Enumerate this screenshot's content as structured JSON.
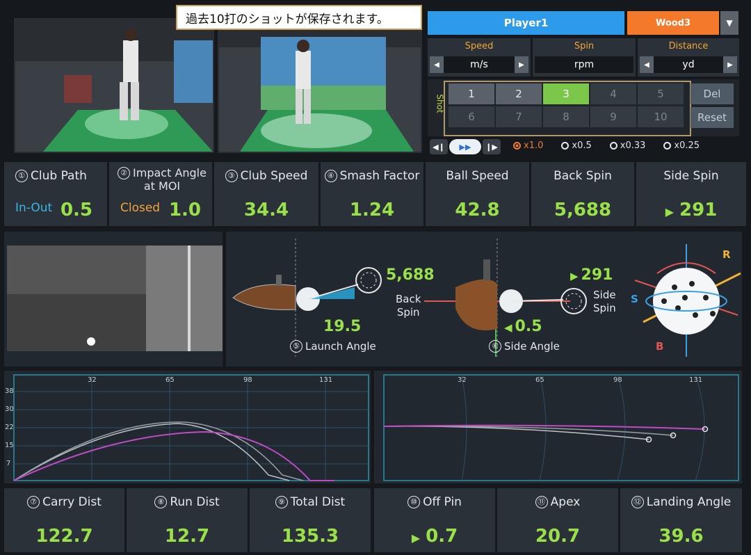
{
  "tooltip": "過去10打のショットが保存されます。",
  "player": {
    "name": "Player1",
    "club": "Wood3"
  },
  "units": [
    {
      "label": "Speed",
      "value": "m/s"
    },
    {
      "label": "Spin",
      "value": "rpm"
    },
    {
      "label": "Distance",
      "value": "yd"
    }
  ],
  "shots": {
    "label": "Shot",
    "items": [
      "1",
      "2",
      "3",
      "4",
      "5",
      "6",
      "7",
      "8",
      "9",
      "10"
    ],
    "selected": "3",
    "del": "Del",
    "reset": "Reset"
  },
  "playback": {
    "speeds": [
      "x1.0",
      "x0.5",
      "x0.33",
      "x0.25"
    ],
    "selected": "x1.0"
  },
  "metrics": [
    {
      "num": "①",
      "title": "Club Path",
      "sub": "In-Out",
      "value": "0.5"
    },
    {
      "num": "②",
      "title": "Impact Angle",
      "title2": "at MOI",
      "sub": "Closed",
      "value": "1.0"
    },
    {
      "num": "③",
      "title": "Club Speed",
      "value": "34.4"
    },
    {
      "num": "④",
      "title": "Smash Factor",
      "value": "1.24"
    },
    {
      "title": "Ball Speed",
      "value": "42.8"
    },
    {
      "title": "Back Spin",
      "value": "5,688"
    },
    {
      "title": "Side Spin",
      "value": "291"
    }
  ],
  "launch": {
    "backspin": "5,688",
    "backspin_label1": "Back",
    "backspin_label2": "Spin",
    "angle": "19.5",
    "num": "⑤",
    "label": "Launch Angle"
  },
  "side": {
    "sidespin": "291",
    "sidespin_label1": "Side",
    "sidespin_label2": "Spin",
    "angle": "0.5",
    "num": "⑥",
    "label": "Side Angle"
  },
  "ball3d": {
    "r": "R",
    "s": "S",
    "b": "B"
  },
  "traj_side": {
    "xticks": [
      "32",
      "65",
      "98",
      "131"
    ],
    "yticks": [
      "38",
      "30",
      "22",
      "15",
      "7"
    ]
  },
  "traj_top": {
    "xticks": [
      "32",
      "65",
      "98",
      "131"
    ]
  },
  "bottom": [
    {
      "num": "⑦",
      "title": "Carry Dist",
      "value": "122.7"
    },
    {
      "num": "⑧",
      "title": "Run Dist",
      "value": "12.7"
    },
    {
      "num": "⑨",
      "title": "Total Dist",
      "value": "135.3"
    },
    {
      "num": "⑩",
      "title": "Off Pin",
      "value": "0.7",
      "arrow": true
    },
    {
      "num": "⑪",
      "title": "Apex",
      "value": "20.7"
    },
    {
      "num": "⑫",
      "title": "Landing Angle",
      "value": "39.6"
    }
  ]
}
